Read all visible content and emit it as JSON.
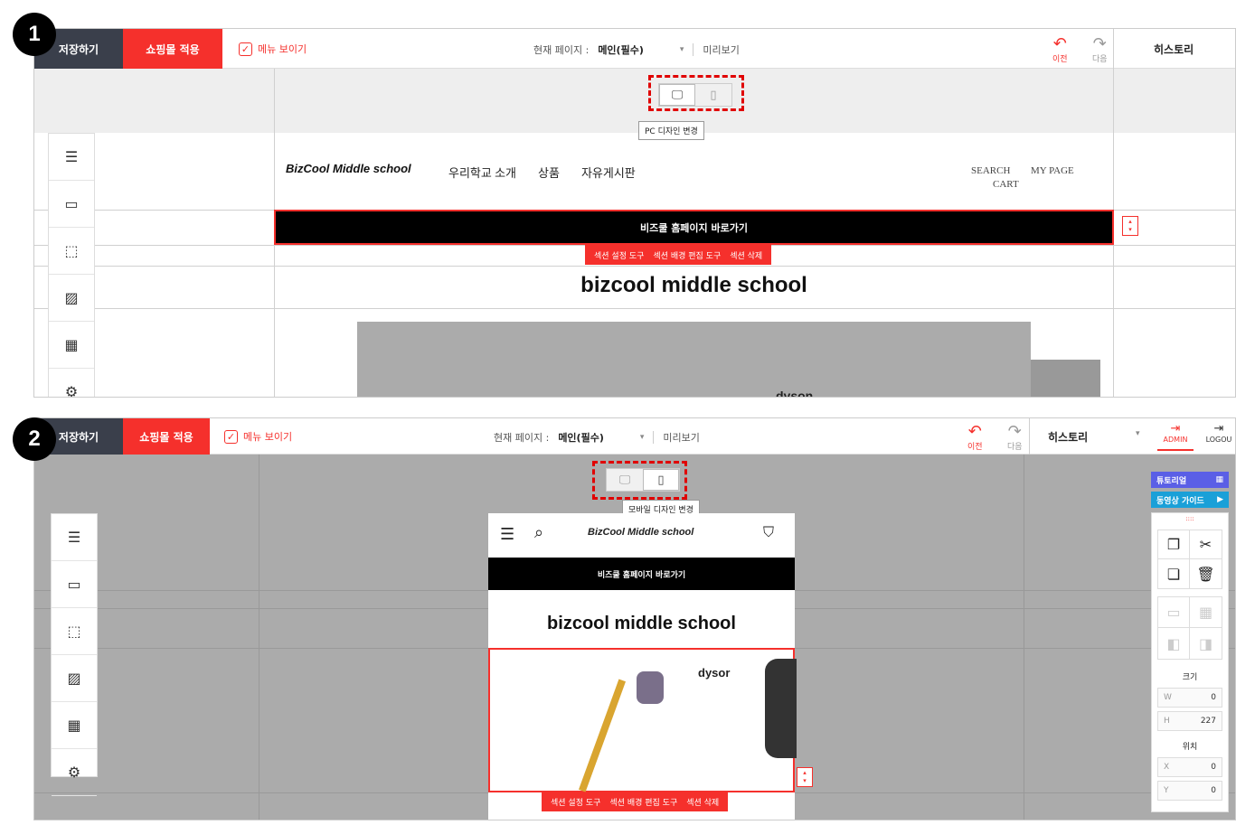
{
  "step_badges": [
    "1",
    "2"
  ],
  "toolbar": {
    "save": "저장하기",
    "apply": "쇼핑몰 적용",
    "menu_show": "메뉴 보이기",
    "check": "✓",
    "current_page_label": "현재 페이지 :",
    "current_page_value": "메인(필수)",
    "preview": "미리보기",
    "undo": "이전",
    "redo": "다음",
    "history": "히스토리",
    "admin": "ADMIN",
    "logout": "LOGOU"
  },
  "panel1": {
    "tooltip": "PC 디자인 변경",
    "logo": "BizCool Middle school",
    "nav": [
      "우리학교 소개",
      "상품",
      "자유게시판"
    ],
    "search": "SEARCH",
    "mypage": "MY PAGE",
    "cart": "CART",
    "banner": "비즈쿨 홈페이지 바로가기",
    "tools": [
      "섹션 설정 도구",
      "섹션 배경 편집 도구",
      "섹션 삭제"
    ],
    "title": "bizcool middle school",
    "brand": "dyson"
  },
  "panel2": {
    "tooltip": "모바일 디자인 변경",
    "logo": "BizCool Middle school",
    "banner": "비즈쿨 홈페이지 바로가기",
    "title": "bizcool middle school",
    "brand": "dysor",
    "tools": [
      "섹션 설정 도구",
      "섹션 배경 편집 도구",
      "섹션 삭제"
    ],
    "tutorial": "튜토리얼",
    "video_guide": "동영상 가이드",
    "size_label": "크기",
    "w_label": "W",
    "w_value": "0",
    "h_label": "H",
    "h_value": "227",
    "pos_label": "위치",
    "x_label": "X",
    "x_value": "0",
    "y_label": "Y",
    "y_value": "0"
  },
  "colors": {
    "accent": "#f5302c",
    "dark": "#3a3f4b",
    "tutorial": "#5a5fe6",
    "video": "#1aa0d8"
  }
}
